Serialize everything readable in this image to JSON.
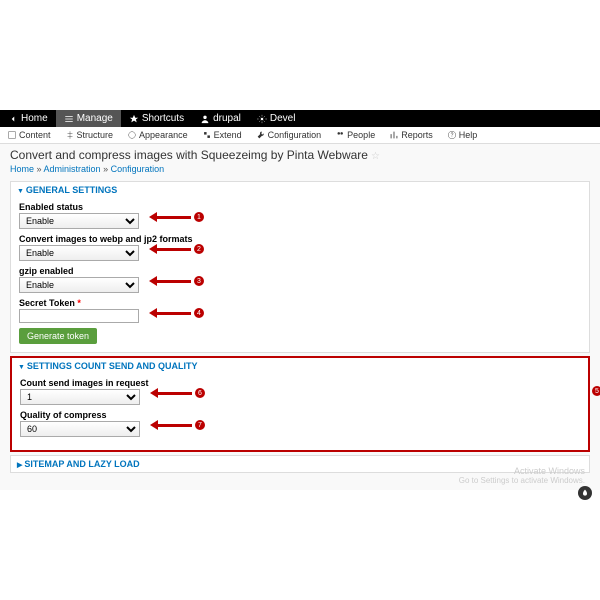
{
  "topbar": {
    "home": "Home",
    "manage": "Manage",
    "shortcuts": "Shortcuts",
    "drupal": "drupal",
    "devel": "Devel"
  },
  "admin": {
    "content": "Content",
    "structure": "Structure",
    "appearance": "Appearance",
    "extend": "Extend",
    "configuration": "Configuration",
    "people": "People",
    "reports": "Reports",
    "help": "Help"
  },
  "page": {
    "title": "Convert and compress images with Squeezeimg by Pinta Webware"
  },
  "crumb": {
    "home": "Home",
    "admin": "Administration",
    "config": "Configuration"
  },
  "sec1": {
    "title": "GENERAL SETTINGS",
    "f1": {
      "label": "Enabled status",
      "value": "Enable"
    },
    "f2": {
      "label": "Convert images to webp and jp2 formats",
      "value": "Enable"
    },
    "f3": {
      "label": "gzip enabled",
      "value": "Enable"
    },
    "f4": {
      "label": "Secret Token",
      "req": "*",
      "value": ""
    },
    "btn": "Generate token"
  },
  "sec2": {
    "title": "SETTINGS COUNT SEND AND QUALITY",
    "f1": {
      "label": "Count send images in request",
      "value": "1"
    },
    "f2": {
      "label": "Quality of compress",
      "value": "60"
    }
  },
  "sec3": {
    "title": "SITEMAP AND LAZY LOAD"
  },
  "markers": {
    "m1": "1",
    "m2": "2",
    "m3": "3",
    "m4": "4",
    "m5": "5",
    "m6": "6",
    "m7": "7"
  },
  "watermark": {
    "l1": "Activate Windows",
    "l2": "Go to Settings to activate Windows."
  }
}
